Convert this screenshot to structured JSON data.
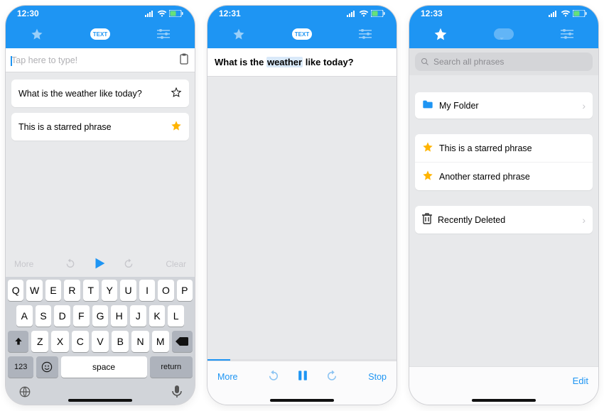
{
  "screen1": {
    "time": "12:30",
    "tab_text_label": "TEXT",
    "input_placeholder": "Tap here to type!",
    "phrases": [
      {
        "text": "What is the weather like today?",
        "starred": false
      },
      {
        "text": "This is a starred phrase",
        "starred": true
      }
    ],
    "controls": {
      "more": "More",
      "clear": "Clear"
    },
    "keyboard": {
      "r1": [
        "Q",
        "W",
        "E",
        "R",
        "T",
        "Y",
        "U",
        "I",
        "O",
        "P"
      ],
      "r2": [
        "A",
        "S",
        "D",
        "F",
        "G",
        "H",
        "J",
        "K",
        "L"
      ],
      "num": "123",
      "space": "space",
      "return": "return"
    }
  },
  "screen2": {
    "time": "12:31",
    "tab_text_label": "TEXT",
    "sentence_pre": "What is the ",
    "sentence_hl": "weather",
    "sentence_post": " like today?",
    "controls": {
      "more": "More",
      "stop": "Stop"
    }
  },
  "screen3": {
    "time": "12:33",
    "search_placeholder": "Search all phrases",
    "folder": "My Folder",
    "starred": [
      "This is a starred phrase",
      "Another starred phrase"
    ],
    "recent": "Recently Deleted",
    "edit": "Edit"
  }
}
